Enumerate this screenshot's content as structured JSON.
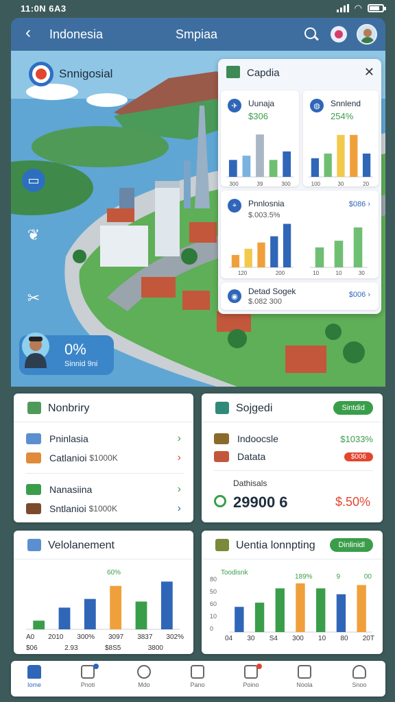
{
  "status_bar": {
    "time": "11:0N 6A3"
  },
  "header": {
    "title": "Indonesia",
    "center_label": "Smpiaa"
  },
  "hero": {
    "title": "Snnigosial",
    "progress": {
      "value": "0%",
      "label": "Sinnid 9ni"
    }
  },
  "overlay": {
    "title": "Capdia",
    "card_a": {
      "title": "Uunaja",
      "value": "$306",
      "labels": [
        "300",
        "39",
        "300"
      ]
    },
    "card_b": {
      "title": "Snnlend",
      "value": "254%",
      "labels": [
        "100",
        "30",
        "20"
      ]
    },
    "card_c": {
      "title": "Pnnlosnia",
      "value": "$.003.5%",
      "link": "$086",
      "labels": [
        "120",
        "200"
      ]
    },
    "card_c_right": {
      "labels": [
        "10",
        "10",
        "30"
      ]
    },
    "card_d": {
      "title": "Detad Sogek",
      "value": "$.082 300",
      "link": "$006"
    }
  },
  "panel_left": {
    "title": "Nonbriry",
    "rows": [
      {
        "label": "Pninlasia",
        "value": ""
      },
      {
        "label": "Catlanioi",
        "value": "$1000K"
      },
      {
        "label": "Nanasiina",
        "value": ""
      },
      {
        "label": "Sntlanioi",
        "value": "$1000K"
      }
    ]
  },
  "panel_right": {
    "title": "Sojgedi",
    "pill": "Sintdid",
    "rows": [
      {
        "label": "Indoocsle",
        "value": "$1033%"
      },
      {
        "label": "Datata",
        "value": "$006"
      }
    ],
    "footer_label": "Dathisals",
    "big_value": "29900 6",
    "big_percent": "$.50%"
  },
  "chart_left": {
    "title": "Velolanement",
    "top_label": "60%",
    "x_labels": [
      "A0",
      "2010",
      "300%",
      "3097",
      "3837",
      "302%"
    ],
    "x_sub_labels": [
      "$06",
      "2.93",
      "$8S5",
      "3800"
    ]
  },
  "chart_right": {
    "title": "Uentia lonnpting",
    "pill": "Dinlinidl",
    "legend_label": "Toodisnk",
    "top_labels": [
      "189%",
      "9",
      "00"
    ],
    "y_ticks": [
      "80",
      "50",
      "60",
      "10",
      "0"
    ],
    "x_labels": [
      "04",
      "30",
      "S4",
      "300",
      "10",
      "80",
      "20T"
    ]
  },
  "bottom_nav": {
    "items": [
      "Iome",
      "Pnoti",
      "Mdo",
      "Pano",
      "Poino",
      "Noola",
      "Snoo"
    ]
  },
  "colors": {
    "background": "#3d5a5a",
    "header": "#3e6ea0",
    "accent_blue": "#2f66b8",
    "accent_green": "#3a9d4a",
    "accent_red": "#e2462f",
    "accent_orange": "#f0a03a",
    "accent_yellow": "#f2c94c"
  },
  "chart_data": [
    {
      "type": "bar",
      "title": "Uunaja",
      "categories": [
        "1",
        "2",
        "3",
        "4",
        "5"
      ],
      "values": [
        4,
        5,
        10,
        4,
        6
      ],
      "colors": [
        "#2f66b8",
        "#7bb3e0",
        "#a9b6c4",
        "#6fbf73",
        "#2f66b8"
      ]
    },
    {
      "type": "bar",
      "title": "Snnlend",
      "categories": [
        "1",
        "2",
        "3",
        "4",
        "5"
      ],
      "values": [
        4,
        5,
        9,
        9,
        5
      ],
      "colors": [
        "#2f66b8",
        "#6fbf73",
        "#f2c94c",
        "#f0a03a",
        "#2f66b8"
      ]
    },
    {
      "type": "bar",
      "title": "Pnnlosnia",
      "categories": [
        "1",
        "2",
        "3",
        "4",
        "5"
      ],
      "values": [
        2,
        3,
        4,
        5,
        7
      ],
      "colors": [
        "#f0a03a",
        "#f2c94c",
        "#f0a03a",
        "#2f66b8",
        "#2f66b8"
      ]
    },
    {
      "type": "bar",
      "title": "",
      "categories": [
        "1",
        "2",
        "3"
      ],
      "values": [
        3,
        4,
        6
      ],
      "colors": [
        "#6fbf73",
        "#6fbf73",
        "#6fbf73"
      ]
    },
    {
      "type": "bar",
      "title": "Velolanement",
      "categories": [
        "1",
        "2",
        "3",
        "4",
        "5",
        "6"
      ],
      "values": [
        1,
        2.5,
        3.5,
        5,
        3.2,
        5.5
      ],
      "colors": [
        "#3a9d4a",
        "#2f66b8",
        "#2f66b8",
        "#f0a03a",
        "#3a9d4a",
        "#2f66b8"
      ]
    },
    {
      "type": "bar",
      "title": "Uentia lonnpting",
      "categories": [
        "1",
        "2",
        "3",
        "4",
        "5",
        "6",
        "7"
      ],
      "values": [
        3,
        3.5,
        5.2,
        5.8,
        5.2,
        4.5,
        5.6
      ],
      "colors": [
        "#2f66b8",
        "#3a9d4a",
        "#3a9d4a",
        "#f0a03a",
        "#3a9d4a",
        "#2f66b8",
        "#f0a03a"
      ]
    }
  ]
}
